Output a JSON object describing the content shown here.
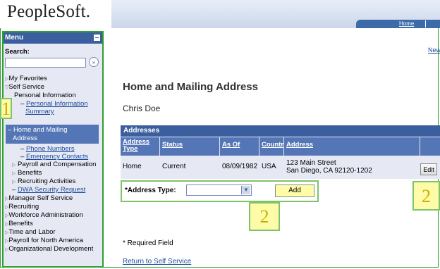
{
  "brand": {
    "logo_text": "PeopleSoft."
  },
  "top_nav": {
    "home": "Home"
  },
  "menu": {
    "title": "Menu",
    "search_label": "Search:",
    "search_value": "",
    "search_go": "»",
    "items": [
      {
        "label": "My Favorites"
      },
      {
        "label": "Self Service"
      },
      {
        "label": "Personal Information"
      },
      {
        "label": "Personal Information"
      },
      {
        "label": "Summary"
      },
      {
        "label": "Home and Mailing"
      },
      {
        "label": "Address"
      },
      {
        "label": "Phone Numbers"
      },
      {
        "label": "Emergency Contacts"
      },
      {
        "label": "Payroll and Compensation"
      },
      {
        "label": "Benefits"
      },
      {
        "label": "Recruiting Activities"
      },
      {
        "label": "DWA Security Request"
      },
      {
        "label": "Manager Self Service"
      },
      {
        "label": "Recruiting"
      },
      {
        "label": "Workforce Administration"
      },
      {
        "label": "Benefits"
      },
      {
        "label": "Time and Labor"
      },
      {
        "label": "Payroll for North America"
      },
      {
        "label": "Organizational Development"
      }
    ]
  },
  "main": {
    "new_link": "New",
    "page_title": "Home and Mailing Address",
    "user_name": "Chris Doe",
    "addresses": {
      "title": "Addresses",
      "columns": [
        "Address Type",
        "Status",
        "As Of",
        "Country",
        "Address"
      ],
      "rows": [
        {
          "type": "Home",
          "status": "Current",
          "as_of": "08/09/1982",
          "country": "USA",
          "address_line1": "123 Main Street",
          "address_line2": "San Diego, CA 92120-1202",
          "edit_label": "Edit"
        }
      ]
    },
    "add_form": {
      "label": "*Address Type:",
      "selected": "",
      "add_button": "Add"
    },
    "required_note": "* Required Field",
    "return_link": "Return to Self Service"
  },
  "callouts": {
    "badge1": "1",
    "badge2a": "2",
    "badge2b": "2"
  }
}
